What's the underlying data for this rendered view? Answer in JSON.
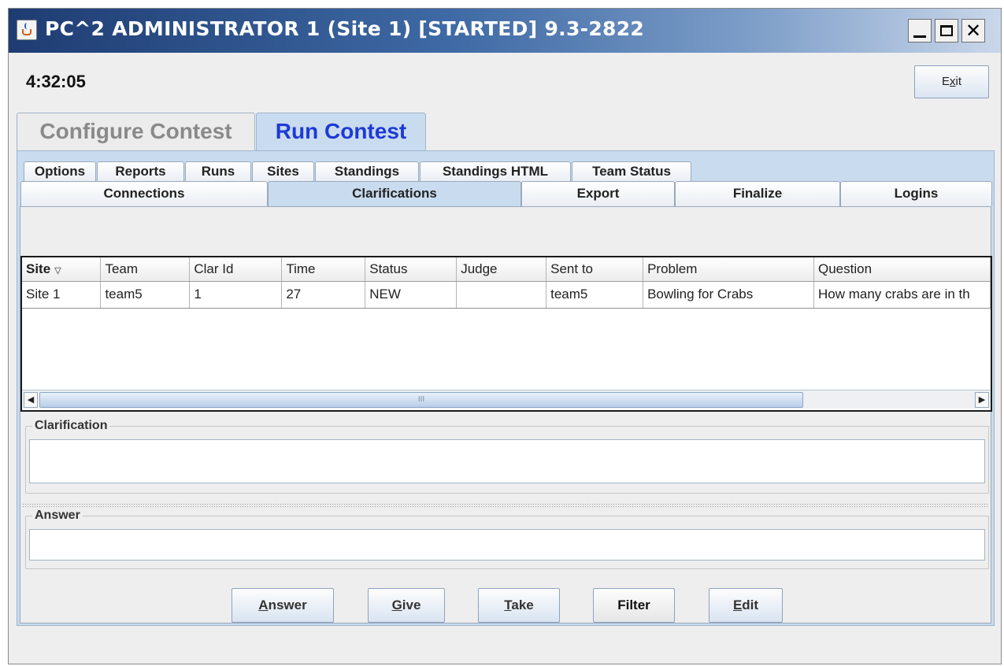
{
  "window": {
    "title": "PC^2 ADMINISTRATOR 1 (Site 1) [STARTED] 9.3-2822",
    "icon": "java-cup-icon",
    "controls": [
      "minimize-icon",
      "maximize-icon",
      "close-icon"
    ]
  },
  "header": {
    "clock": "4:32:05",
    "exit_label": "Exit"
  },
  "main_tabs": [
    {
      "label": "Configure Contest",
      "active": false
    },
    {
      "label": "Run Contest",
      "active": true
    }
  ],
  "sub_tabs_row1": [
    "Options",
    "Reports",
    "Runs",
    "Sites",
    "Standings",
    "Standings HTML",
    "Team Status"
  ],
  "sub_tabs_row2": [
    "Connections",
    "Clarifications",
    "Export",
    "Finalize",
    "Logins"
  ],
  "active_sub_tab": "Clarifications",
  "table": {
    "columns": [
      "Site",
      "Team",
      "Clar Id",
      "Time",
      "Status",
      "Judge",
      "Sent to",
      "Problem",
      "Question"
    ],
    "sorted_column": "Site",
    "rows": [
      [
        "Site 1",
        "team5",
        "1",
        "27",
        "NEW",
        "",
        "team5",
        "Bowling for Crabs",
        "How many crabs are in th"
      ]
    ]
  },
  "scrollbar": {
    "thumb_grip": "III"
  },
  "clarification_label": "Clarification",
  "clarification_text": "",
  "answer_label": "Answer",
  "answer_text": "",
  "buttons": {
    "answer": "Answer",
    "give": "Give",
    "take": "Take",
    "filter": "Filter",
    "edit": "Edit"
  },
  "colors": {
    "titlebar_start": "#1e3c72",
    "active_tab_text": "#1d3ad6",
    "panel_bg": "#c9dbef"
  }
}
